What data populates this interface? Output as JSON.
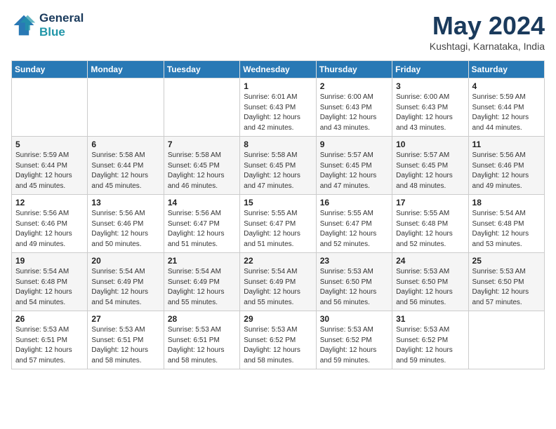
{
  "header": {
    "logo_line1": "General",
    "logo_line2": "Blue",
    "month_title": "May 2024",
    "location": "Kushtagi, Karnataka, India"
  },
  "weekdays": [
    "Sunday",
    "Monday",
    "Tuesday",
    "Wednesday",
    "Thursday",
    "Friday",
    "Saturday"
  ],
  "weeks": [
    [
      {
        "day": "",
        "info": ""
      },
      {
        "day": "",
        "info": ""
      },
      {
        "day": "",
        "info": ""
      },
      {
        "day": "1",
        "info": "Sunrise: 6:01 AM\nSunset: 6:43 PM\nDaylight: 12 hours\nand 42 minutes."
      },
      {
        "day": "2",
        "info": "Sunrise: 6:00 AM\nSunset: 6:43 PM\nDaylight: 12 hours\nand 43 minutes."
      },
      {
        "day": "3",
        "info": "Sunrise: 6:00 AM\nSunset: 6:43 PM\nDaylight: 12 hours\nand 43 minutes."
      },
      {
        "day": "4",
        "info": "Sunrise: 5:59 AM\nSunset: 6:44 PM\nDaylight: 12 hours\nand 44 minutes."
      }
    ],
    [
      {
        "day": "5",
        "info": "Sunrise: 5:59 AM\nSunset: 6:44 PM\nDaylight: 12 hours\nand 45 minutes."
      },
      {
        "day": "6",
        "info": "Sunrise: 5:58 AM\nSunset: 6:44 PM\nDaylight: 12 hours\nand 45 minutes."
      },
      {
        "day": "7",
        "info": "Sunrise: 5:58 AM\nSunset: 6:45 PM\nDaylight: 12 hours\nand 46 minutes."
      },
      {
        "day": "8",
        "info": "Sunrise: 5:58 AM\nSunset: 6:45 PM\nDaylight: 12 hours\nand 47 minutes."
      },
      {
        "day": "9",
        "info": "Sunrise: 5:57 AM\nSunset: 6:45 PM\nDaylight: 12 hours\nand 47 minutes."
      },
      {
        "day": "10",
        "info": "Sunrise: 5:57 AM\nSunset: 6:45 PM\nDaylight: 12 hours\nand 48 minutes."
      },
      {
        "day": "11",
        "info": "Sunrise: 5:56 AM\nSunset: 6:46 PM\nDaylight: 12 hours\nand 49 minutes."
      }
    ],
    [
      {
        "day": "12",
        "info": "Sunrise: 5:56 AM\nSunset: 6:46 PM\nDaylight: 12 hours\nand 49 minutes."
      },
      {
        "day": "13",
        "info": "Sunrise: 5:56 AM\nSunset: 6:46 PM\nDaylight: 12 hours\nand 50 minutes."
      },
      {
        "day": "14",
        "info": "Sunrise: 5:56 AM\nSunset: 6:47 PM\nDaylight: 12 hours\nand 51 minutes."
      },
      {
        "day": "15",
        "info": "Sunrise: 5:55 AM\nSunset: 6:47 PM\nDaylight: 12 hours\nand 51 minutes."
      },
      {
        "day": "16",
        "info": "Sunrise: 5:55 AM\nSunset: 6:47 PM\nDaylight: 12 hours\nand 52 minutes."
      },
      {
        "day": "17",
        "info": "Sunrise: 5:55 AM\nSunset: 6:48 PM\nDaylight: 12 hours\nand 52 minutes."
      },
      {
        "day": "18",
        "info": "Sunrise: 5:54 AM\nSunset: 6:48 PM\nDaylight: 12 hours\nand 53 minutes."
      }
    ],
    [
      {
        "day": "19",
        "info": "Sunrise: 5:54 AM\nSunset: 6:48 PM\nDaylight: 12 hours\nand 54 minutes."
      },
      {
        "day": "20",
        "info": "Sunrise: 5:54 AM\nSunset: 6:49 PM\nDaylight: 12 hours\nand 54 minutes."
      },
      {
        "day": "21",
        "info": "Sunrise: 5:54 AM\nSunset: 6:49 PM\nDaylight: 12 hours\nand 55 minutes."
      },
      {
        "day": "22",
        "info": "Sunrise: 5:54 AM\nSunset: 6:49 PM\nDaylight: 12 hours\nand 55 minutes."
      },
      {
        "day": "23",
        "info": "Sunrise: 5:53 AM\nSunset: 6:50 PM\nDaylight: 12 hours\nand 56 minutes."
      },
      {
        "day": "24",
        "info": "Sunrise: 5:53 AM\nSunset: 6:50 PM\nDaylight: 12 hours\nand 56 minutes."
      },
      {
        "day": "25",
        "info": "Sunrise: 5:53 AM\nSunset: 6:50 PM\nDaylight: 12 hours\nand 57 minutes."
      }
    ],
    [
      {
        "day": "26",
        "info": "Sunrise: 5:53 AM\nSunset: 6:51 PM\nDaylight: 12 hours\nand 57 minutes."
      },
      {
        "day": "27",
        "info": "Sunrise: 5:53 AM\nSunset: 6:51 PM\nDaylight: 12 hours\nand 58 minutes."
      },
      {
        "day": "28",
        "info": "Sunrise: 5:53 AM\nSunset: 6:51 PM\nDaylight: 12 hours\nand 58 minutes."
      },
      {
        "day": "29",
        "info": "Sunrise: 5:53 AM\nSunset: 6:52 PM\nDaylight: 12 hours\nand 58 minutes."
      },
      {
        "day": "30",
        "info": "Sunrise: 5:53 AM\nSunset: 6:52 PM\nDaylight: 12 hours\nand 59 minutes."
      },
      {
        "day": "31",
        "info": "Sunrise: 5:53 AM\nSunset: 6:52 PM\nDaylight: 12 hours\nand 59 minutes."
      },
      {
        "day": "",
        "info": ""
      }
    ]
  ]
}
